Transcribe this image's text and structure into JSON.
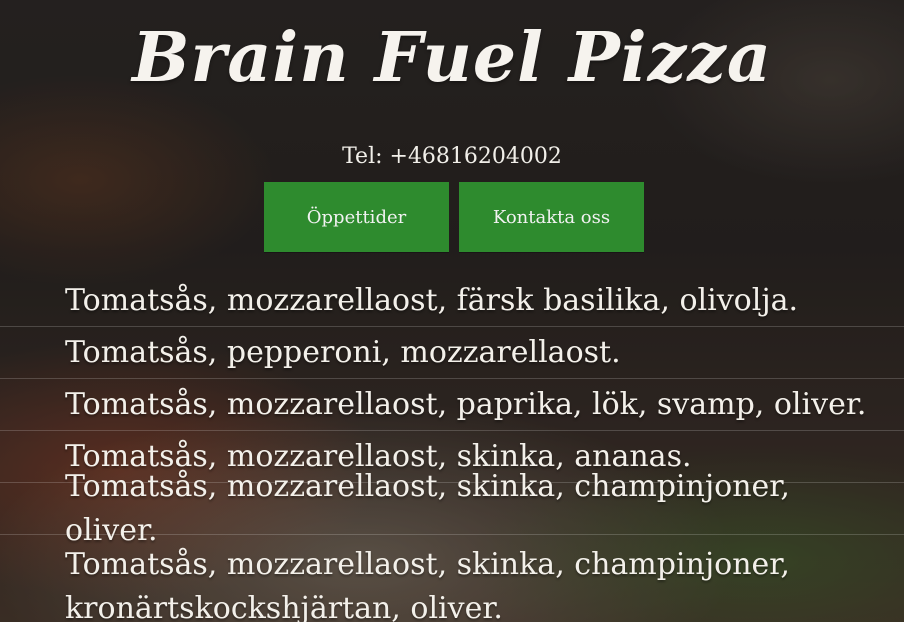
{
  "header": {
    "title": "Brain Fuel Pizza",
    "tel": "Tel: +46816204002"
  },
  "buttons": [
    {
      "label": "Öppettider"
    },
    {
      "label": "Kontakta oss"
    }
  ],
  "menu": {
    "items": [
      {
        "description": "Tomatsås, mozzarellaost, färsk basilika, olivolja."
      },
      {
        "description": "Tomatsås, pepperoni, mozzarellaost."
      },
      {
        "description": "Tomatsås, mozzarellaost, paprika, lök, svamp, oliver."
      },
      {
        "description": "Tomatsås, mozzarellaost, skinka, ananas."
      },
      {
        "description": "Tomatsås, mozzarellaost, skinka, champinjoner, oliver."
      },
      {
        "description": "Tomatsås, mozzarellaost, skinka, champinjoner, kronärtskockshjärtan, oliver."
      }
    ]
  },
  "colors": {
    "accent_button": "#2e8b2e",
    "text": "#f3f0ea"
  }
}
